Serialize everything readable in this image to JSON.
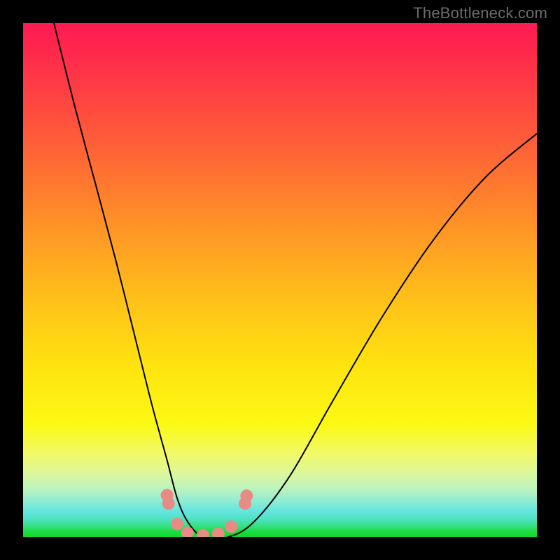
{
  "watermark": "TheBottleneck.com",
  "chart_data": {
    "type": "line",
    "title": "",
    "xlabel": "",
    "ylabel": "",
    "xlim": [
      0,
      1
    ],
    "ylim": [
      0,
      1
    ],
    "legend": false,
    "grid": false,
    "background_gradient": {
      "stops": [
        {
          "pos": 0.0,
          "color": "#ff1a52"
        },
        {
          "pos": 0.5,
          "color": "#ffbb1b"
        },
        {
          "pos": 0.78,
          "color": "#fbf913"
        },
        {
          "pos": 0.95,
          "color": "#63e5df"
        },
        {
          "pos": 1.0,
          "color": "#0fd92a"
        }
      ]
    },
    "series": [
      {
        "name": "v-curve",
        "color": "#000000",
        "width": 2,
        "x": [
          0.06,
          0.1,
          0.14,
          0.18,
          0.22,
          0.25,
          0.28,
          0.3,
          0.32,
          0.35,
          0.4,
          0.45,
          0.52,
          0.6,
          0.7,
          0.8,
          0.9,
          1.0
        ],
        "y": [
          1.0,
          0.84,
          0.69,
          0.54,
          0.38,
          0.26,
          0.15,
          0.075,
          0.03,
          0.0,
          0.0,
          0.03,
          0.12,
          0.26,
          0.43,
          0.58,
          0.7,
          0.785
        ]
      },
      {
        "name": "trough-highlight",
        "color": "#e98b85",
        "type": "scatter",
        "marker_size": 9,
        "x": [
          0.28,
          0.283,
          0.3,
          0.32,
          0.35,
          0.38,
          0.405,
          0.432,
          0.435
        ],
        "y": [
          0.081,
          0.065,
          0.025,
          0.008,
          0.003,
          0.006,
          0.02,
          0.065,
          0.08
        ]
      }
    ],
    "annotations": []
  }
}
